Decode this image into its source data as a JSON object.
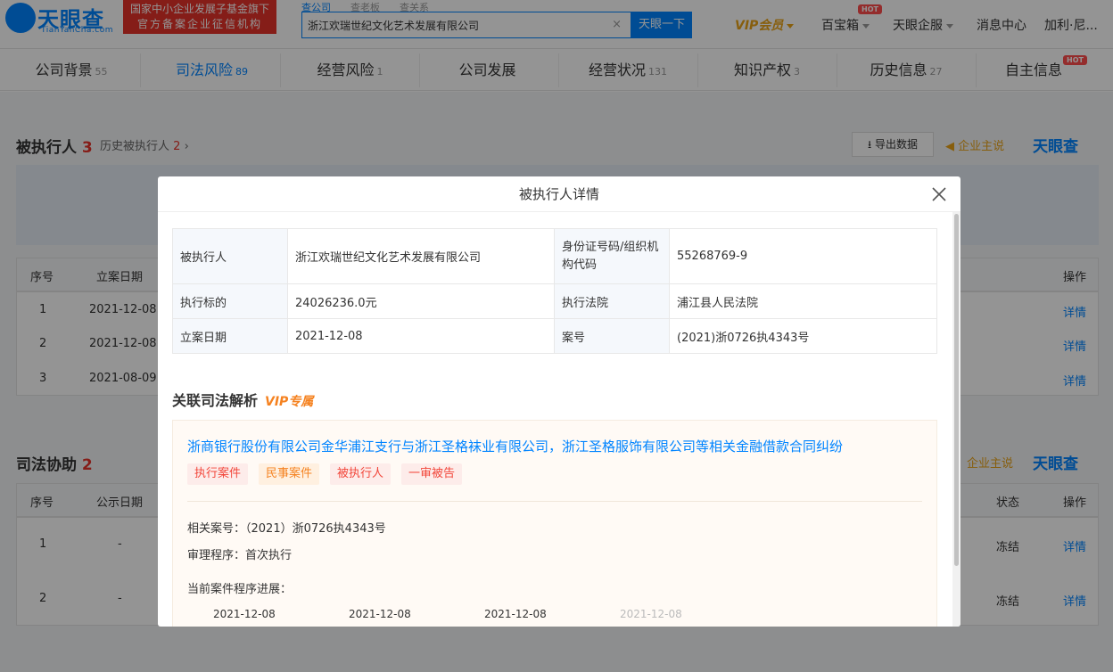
{
  "header": {
    "logo_text": "天眼查",
    "logo_sub": "TianYanCha.com",
    "gov_line1": "国家中小企业发展子基金旗下",
    "gov_line2": "官方备案企业征信机构",
    "search_tabs": [
      "查公司",
      "查老板",
      "查关系"
    ],
    "search_value": "浙江欢瑞世纪文化艺术发展有限公司",
    "search_clear": "×",
    "search_button": "天眼一下",
    "nav": {
      "vip": "VIP会员",
      "baibao": "百宝箱",
      "hot": "HOT",
      "qiye": "天眼企服",
      "messages": "消息中心",
      "user": "加利·尼..."
    }
  },
  "tabs": [
    {
      "label": "公司背景",
      "count": "55"
    },
    {
      "label": "司法风险",
      "count": "89"
    },
    {
      "label": "经营风险",
      "count": "1"
    },
    {
      "label": "公司发展",
      "count": ""
    },
    {
      "label": "经营状况",
      "count": "131"
    },
    {
      "label": "知识产权",
      "count": "3"
    },
    {
      "label": "历史信息",
      "count": "27"
    },
    {
      "label": "自主信息",
      "count": ""
    }
  ],
  "background": {
    "executed": {
      "title": "被执行人",
      "count": "3",
      "history_label": "历史被执行人",
      "history_count": "2",
      "export": "导出数据",
      "enterprise": "企业主说",
      "brand": "天眼查",
      "col_no": "序号",
      "col_date": "立案日期",
      "col_op": "操作",
      "rows": [
        {
          "no": "1",
          "date": "2021-12-08",
          "op": "详情"
        },
        {
          "no": "2",
          "date": "2021-12-08",
          "op": "详情"
        },
        {
          "no": "3",
          "date": "2021-08-09",
          "op": "详情"
        }
      ]
    },
    "assist": {
      "title": "司法协助",
      "count": "2",
      "enterprise": "企业主说",
      "brand": "天眼查",
      "col_no": "序号",
      "col_date": "公示日期",
      "col_status": "状态",
      "col_op": "操作",
      "rows": [
        {
          "no": "1",
          "date": "-",
          "status": "冻结",
          "op": "详情"
        },
        {
          "no": "2",
          "date": "-",
          "status": "冻结",
          "op": "详情"
        }
      ]
    }
  },
  "modal": {
    "title": "被执行人详情",
    "fields": {
      "executed_label": "被执行人",
      "executed_value": "浙江欢瑞世纪文化艺术发展有限公司",
      "id_label": "身份证号码/组织机构代码",
      "id_value": "55268769-9",
      "target_label": "执行标的",
      "target_value": "24026236.0元",
      "court_label": "执行法院",
      "court_value": "浦江县人民法院",
      "filing_label": "立案日期",
      "filing_value": "2021-12-08",
      "case_label": "案号",
      "case_value": "(2021)浙0726执4343号"
    },
    "related_title": "关联司法解析",
    "vip_label": "VIP专属",
    "case": {
      "title": "浙商银行股份有限公司金华浦江支行与浙江圣格袜业有限公司，浙江圣格服饰有限公司等相关金融借款合同纠纷",
      "tags": [
        {
          "label": "执行案件",
          "color": "#f2463a",
          "bg": "#fdecea"
        },
        {
          "label": "民事案件",
          "color": "#f58220",
          "bg": "#fff0e0"
        },
        {
          "label": "被执行人",
          "color": "#f2463a",
          "bg": "#fdecea"
        },
        {
          "label": "一审被告",
          "color": "#f2463a",
          "bg": "#fdecea"
        }
      ],
      "related_case_no": "相关案号：（2021）浙0726执4343号",
      "procedure": "审理程序：首次执行",
      "progress_label": "当前案件程序进展：",
      "dates": [
        "2021-12-08",
        "2021-12-08",
        "2021-12-08",
        "2021-12-08"
      ]
    }
  },
  "colors": {
    "brand": "#0084ff",
    "red": "#e5332a",
    "vip": "#e8a317"
  }
}
